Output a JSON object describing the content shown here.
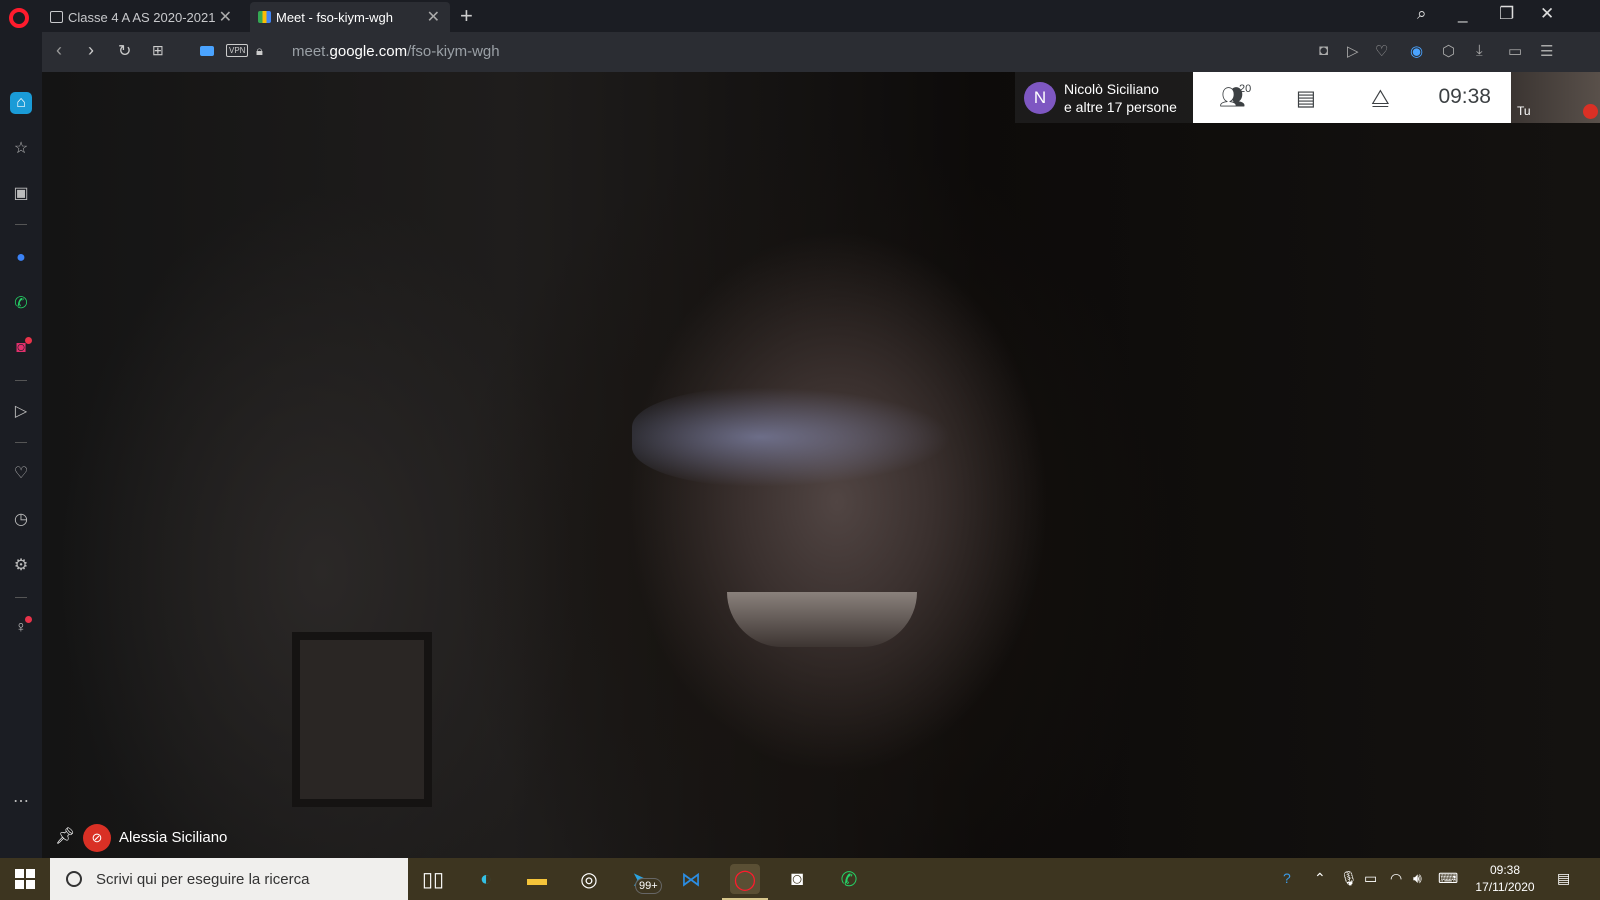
{
  "browser": {
    "tabs": [
      {
        "title": "Classe 4 A AS 2020-2021"
      },
      {
        "title": "Meet - fso-kiym-wgh"
      }
    ],
    "new_tab_symbol": "+",
    "address": {
      "prefix": "meet.",
      "domain": "google.com",
      "path": "/fso-kiym-wgh"
    },
    "vpn_label": "VPN"
  },
  "meet": {
    "participants_line1": "Nicolò Siciliano",
    "participants_line2": "e altre 17 persone",
    "avatar_letter": "N",
    "avatar_color": "#7e57c2",
    "participant_count": "20",
    "clock": "09:38",
    "self_label": "Tu",
    "active_speaker": "Alessia Siciliano",
    "mute_color": "#d93025"
  },
  "taskbar": {
    "search_placeholder": "Scrivi qui per eseguire la ricerca",
    "telegram_badge": "99+",
    "time": "09:38",
    "date": "17/11/2020"
  }
}
